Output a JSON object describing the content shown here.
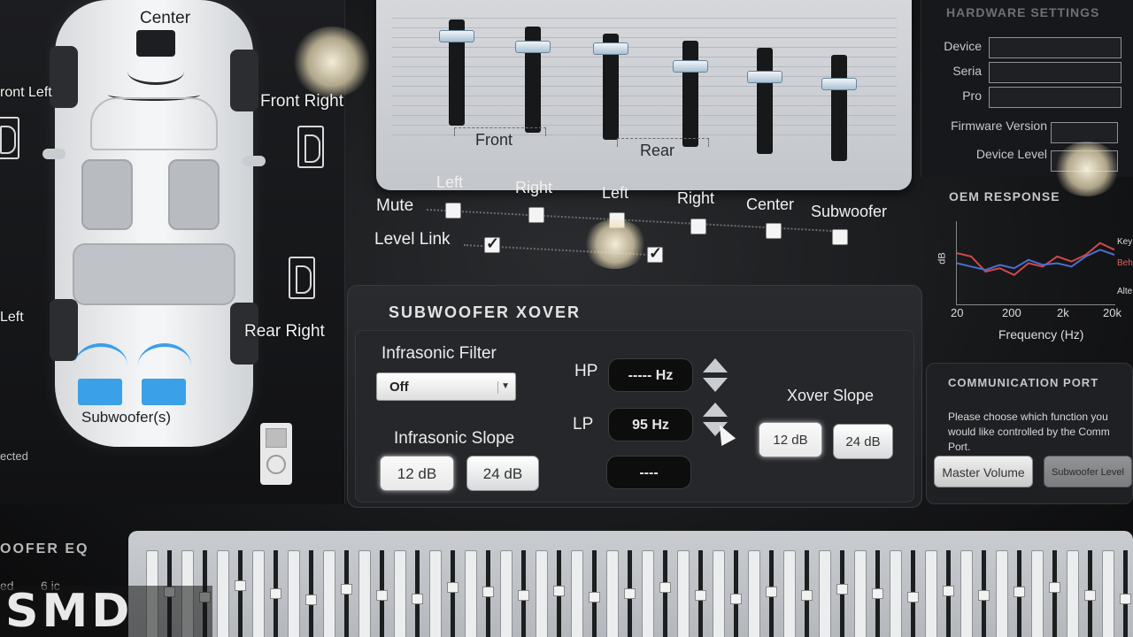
{
  "car": {
    "center_label": "Center",
    "front_left_label": "ront Left",
    "front_right_label": "Front Right",
    "rear_left_label": "Left",
    "rear_right_label": "Rear Right",
    "subwoofer_label": "Subwoofer(s)",
    "connected_label": "ected"
  },
  "fader_bank": {
    "front_label": "Front",
    "rear_label": "Rear",
    "levels": [
      0.88,
      0.84,
      0.9,
      0.78,
      0.74,
      0.74
    ]
  },
  "channels": {
    "headers": [
      "Left",
      "Right",
      "Left",
      "Right",
      "Center",
      "Subwoofer"
    ],
    "mute_label": "Mute",
    "level_link_label": "Level Link",
    "mute": [
      false,
      false,
      false,
      false,
      false,
      false
    ],
    "level_link": [
      true,
      true
    ]
  },
  "xover": {
    "title": "SUBWOOFER XOVER",
    "infrasonic_filter_label": "Infrasonic Filter",
    "infrasonic_filter_value": "Off",
    "infrasonic_slope_label": "Infrasonic Slope",
    "slope_12": "12 dB",
    "slope_24": "24 dB",
    "hp_label": "HP",
    "hp_value": "----- Hz",
    "lp_label": "LP",
    "lp_value": "95 Hz",
    "third_value": "----",
    "xover_slope_label": "Xover Slope",
    "xover_12": "12 dB",
    "xover_24": "24 dB"
  },
  "device_info": {
    "title": "HARDWARE SETTINGS",
    "device_label": "Device",
    "serial_label": "Seria",
    "prod_label": "Pro",
    "firmware_label": "Firmware Version",
    "level_label": "Device Level"
  },
  "oem": {
    "title": "OEM RESPONSE",
    "xlabel": "Frequency (Hz)",
    "ylabel": "dB",
    "ticks": [
      "20",
      "200",
      "2k",
      "20k"
    ],
    "legend": [
      "Key",
      "Beh",
      "Alte"
    ],
    "red_series": [
      0.62,
      0.58,
      0.4,
      0.44,
      0.36,
      0.5,
      0.46,
      0.58,
      0.52,
      0.6,
      0.74,
      0.66
    ],
    "blue_series": [
      0.5,
      0.46,
      0.42,
      0.48,
      0.44,
      0.54,
      0.48,
      0.5,
      0.46,
      0.58,
      0.66,
      0.6
    ]
  },
  "comm_port": {
    "title": "COMMUNICATION PORT",
    "text": "Please choose which function you would like controlled by the Comm Port.",
    "btn_master": "Master Volume",
    "btn_sub": "Subwoofer Level"
  },
  "sub_eq": {
    "title": "OOFER EQ",
    "levels": [
      0.55,
      0.48,
      0.62,
      0.52,
      0.44,
      0.58,
      0.5,
      0.46,
      0.6,
      0.54,
      0.5,
      0.56,
      0.48,
      0.52,
      0.6,
      0.5,
      0.46,
      0.55,
      0.5,
      0.58,
      0.52,
      0.48,
      0.56,
      0.5,
      0.54,
      0.6,
      0.5,
      0.46
    ]
  },
  "left_bottom_labels": [
    "ed",
    "6 ic"
  ],
  "watermark": "SMD"
}
